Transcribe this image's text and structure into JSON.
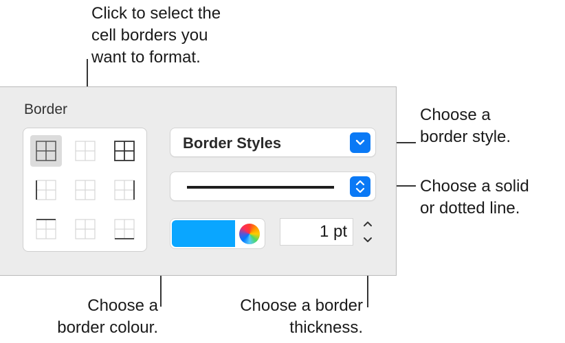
{
  "callouts": {
    "select_borders": [
      "Click to select the",
      "cell borders you",
      "want to format."
    ],
    "border_style": [
      "Choose a",
      "border style."
    ],
    "line_type": [
      "Choose a solid",
      "or dotted line."
    ],
    "border_colour": [
      "Choose a",
      "border colour."
    ],
    "border_thickness": [
      "Choose a border",
      "thickness."
    ]
  },
  "inspector": {
    "section_title": "Border",
    "border_style_popup": {
      "label": "Border Styles",
      "icon": "chevron-down-icon"
    },
    "line_style_popup": {
      "value": "solid",
      "icon": "up-down-chevron-icon"
    },
    "colour_well": {
      "color": "#0aa6ff",
      "icon": "color-wheel-icon"
    },
    "thickness": {
      "value": "1 pt",
      "icon": "stepper-icon"
    },
    "border_grid": {
      "selected": "all-borders",
      "items": [
        "all-borders",
        "inside-borders",
        "outside-borders",
        "left-border",
        "inner-vertical-border",
        "right-border",
        "top-border",
        "inner-horizontal-border",
        "bottom-border"
      ]
    }
  },
  "colors": {
    "accent": "#0a79f5",
    "panel": "#ececec",
    "swatch": "#0aa6ff"
  }
}
